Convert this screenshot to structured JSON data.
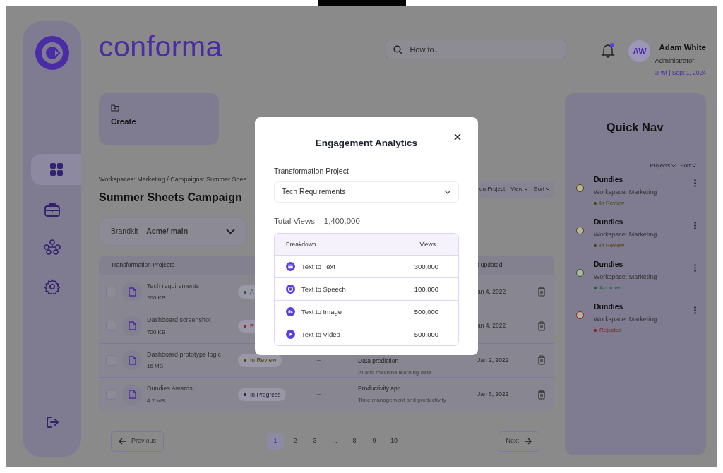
{
  "sidebar": {
    "nav_items": [
      {
        "selected": true
      },
      {
        "selected": false
      },
      {
        "selected": false
      },
      {
        "selected": false
      }
    ]
  },
  "header": {
    "logo": "conforma",
    "search": {
      "placeholder": "How to.."
    },
    "notifications": {
      "unread": true
    },
    "user": {
      "initials": "AW",
      "name": "Adam White",
      "role": "Administrator",
      "timestamp": "3PM | Sept 1, 2024"
    }
  },
  "main": {
    "create_label": "Create",
    "breadcrumb": "Workspaces: Marketing / Campaigns: Summer Shee",
    "title": "Summer Sheets Campaign",
    "brandkit": "Brandkit – **Acme/ main**",
    "toolbar": [
      {
        "label": "on Project",
        "dropdown": false
      },
      {
        "label": "View",
        "dropdown": true
      },
      {
        "label": "Sort",
        "dropdown": true
      }
    ],
    "table": {
      "columns": [
        {
          "label": "Transformation Projects"
        },
        {
          "label": "t updated"
        }
      ],
      "rows": [
        {
          "checked": false,
          "name": "Tech requirements",
          "size": "200 KB",
          "status": {
            "label": "A",
            "color": "#17603a"
          },
          "updated": "an 4, 2022"
        },
        {
          "checked": false,
          "name": "Dashboard screenshot",
          "size": "720 KB",
          "status": {
            "label": "R",
            "color": "#8e1c1c"
          },
          "updated": "an 4, 2022"
        },
        {
          "checked": false,
          "name": "Dashboard prototype logic",
          "size": "16 MB",
          "status": {
            "label": "In Review",
            "color": "#4d400a"
          },
          "column_3": "–",
          "description_title": "Data prediction",
          "description": "AI and machine learning data",
          "updated": "Jan 2, 2022"
        },
        {
          "checked": false,
          "name": "Dundies Awards",
          "size": "4.2 MB",
          "status": {
            "label": "In Progress",
            "color": "#23233a"
          },
          "column_3": "–",
          "description_title": "Productivity app",
          "description": "Time management and productivity",
          "updated": "Jan 6, 2022"
        }
      ]
    },
    "pagination": {
      "previous": "Previous",
      "next": "Next",
      "pages": [
        {
          "label": "1",
          "selected": true
        },
        {
          "label": "2",
          "selected": false
        },
        {
          "label": "3",
          "selected": false
        },
        {
          "label": "...",
          "selected": false
        },
        {
          "label": "8",
          "selected": false
        },
        {
          "label": "9",
          "selected": false
        },
        {
          "label": "10",
          "selected": false
        }
      ]
    }
  },
  "quick_nav": {
    "title": "Quick Nav",
    "filters": [
      {
        "label": "Projects"
      },
      {
        "label": "Sort"
      }
    ],
    "items": [
      {
        "name": "Dundies",
        "workspace": "Workspace: Marketing",
        "status": "In Review",
        "color": "#4d400a"
      },
      {
        "name": "Dundies",
        "workspace": "Workspace: Marketing",
        "status": "In Review",
        "color": "#4d400a"
      },
      {
        "name": "Dundies",
        "workspace": "Workspace: Marketing",
        "status": "Approved",
        "color": "#17603a"
      },
      {
        "name": "Dundies",
        "workspace": "Workspace: Marketing",
        "status": "Rejected",
        "color": "#8e1c1c"
      }
    ]
  },
  "modal": {
    "title": "Engagement Analytics",
    "field_label": "Transformation Project",
    "selected_project": "Tech Requirements",
    "total": "Total Views – 1,400,000",
    "table": {
      "columns": [
        "Breakdown",
        "Views"
      ],
      "rows": [
        {
          "label": "Text to Text",
          "views": "300,000"
        },
        {
          "label": "Text to Speech",
          "views": "100,000"
        },
        {
          "label": "Text to Image",
          "views": "500,000"
        },
        {
          "label": "Text to Video",
          "views": "500,000"
        }
      ]
    }
  }
}
